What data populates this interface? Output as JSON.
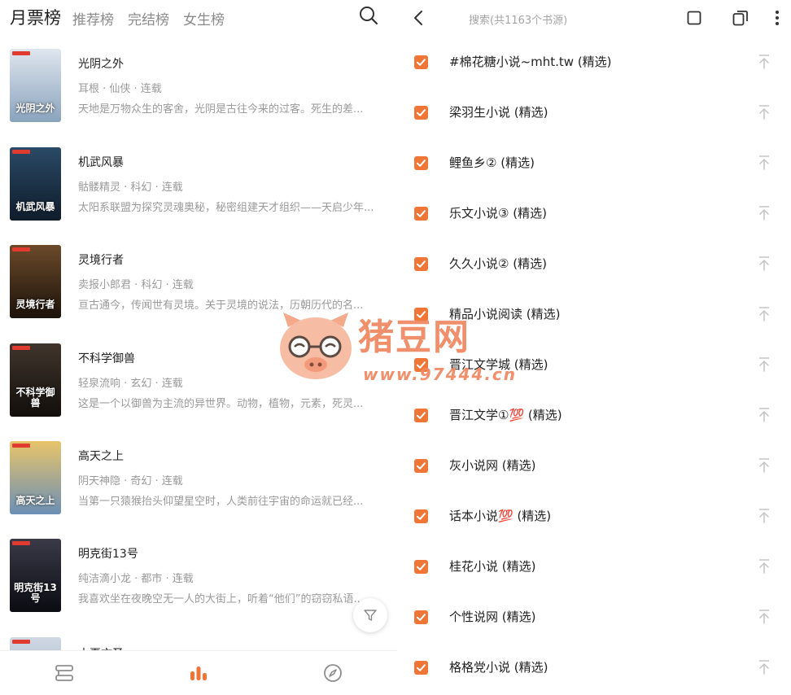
{
  "left": {
    "tabs": [
      {
        "label": "月票榜",
        "active": true
      },
      {
        "label": "推荐榜",
        "active": false
      },
      {
        "label": "完结榜",
        "active": false
      },
      {
        "label": "女生榜",
        "active": false
      }
    ],
    "books": [
      {
        "title": "光阴之外",
        "meta": "耳根 · 仙侠 · 连载",
        "desc": "天地是万物众生的客舍，光阴是古往今来的过客。死生的差...",
        "cover_text": "光阴之外",
        "cover_colors": [
          "#dfe6ee",
          "#8aa3bd"
        ]
      },
      {
        "title": "机武风暴",
        "meta": "骷髅精灵 · 科幻 · 连载",
        "desc": "太阳系联盟为探究灵魂奥秘，秘密组建天才组织——天启少年...",
        "cover_text": "机武风暴",
        "cover_colors": [
          "#2a4a66",
          "#0f1c2b"
        ]
      },
      {
        "title": "灵境行者",
        "meta": "卖报小郎君 · 科幻 · 连载",
        "desc": "亘古通今，传闻世有灵境。关于灵境的说法，历朝历代的名...",
        "cover_text": "灵境行者",
        "cover_colors": [
          "#6b4a2a",
          "#1c120a"
        ]
      },
      {
        "title": "不科学御兽",
        "meta": "轻泉流响 · 玄幻 · 连载",
        "desc": "这是一个以御兽为主流的异世界。动物，植物，元素，死灵...",
        "cover_text": "不科学御兽",
        "cover_colors": [
          "#40352c",
          "#120e0b"
        ]
      },
      {
        "title": "高天之上",
        "meta": "阴天神隐 · 奇幻 · 连载",
        "desc": "当第一只猿猴抬头仰望星空时，人类前往宇宙的命运就已经...",
        "cover_text": "高天之上",
        "cover_colors": [
          "#e8c46a",
          "#6b8fb5"
        ]
      },
      {
        "title": "明克街13号",
        "meta": "纯洁滴小龙 · 都市 · 连载",
        "desc": "我喜欢坐在夜晚空无一人的大街上，听着“他们”的窃窃私语...",
        "cover_text": "明克街13号",
        "cover_colors": [
          "#3a3a48",
          "#0b0b12"
        ]
      },
      {
        "title": "大夏文圣",
        "meta": "",
        "desc": "",
        "cover_text": "",
        "cover_colors": [
          "#cfd8e3",
          "#9aaabb"
        ]
      }
    ],
    "nav": [
      "bookshelf-icon",
      "ranking-icon",
      "discover-icon"
    ],
    "accent": "#ef7637"
  },
  "right": {
    "search_placeholder": "搜索(共1163个书源)",
    "sources": [
      {
        "name": "#棉花糖小说~mht.tw (精选)",
        "checked": true
      },
      {
        "name": "梁羽生小说 (精选)",
        "checked": true
      },
      {
        "name": "鲤鱼乡② (精选)",
        "checked": true
      },
      {
        "name": "乐文小说③ (精选)",
        "checked": true
      },
      {
        "name": "久久小说② (精选)",
        "checked": true
      },
      {
        "name": "精品小说阅读 (精选)",
        "checked": true
      },
      {
        "name": "晋江文学城 (精选)",
        "checked": true
      },
      {
        "name": "晋江文学①💯 (精选)",
        "checked": true
      },
      {
        "name": "灰小说网 (精选)",
        "checked": true
      },
      {
        "name": "话本小说💯 (精选)",
        "checked": true
      },
      {
        "name": "桂花小说 (精选)",
        "checked": true
      },
      {
        "name": "个性说网 (精选)",
        "checked": true
      },
      {
        "name": "格格党小说 (精选)",
        "checked": true
      }
    ],
    "checkbox_color": "#ef7637"
  },
  "watermark": {
    "text": "猪豆网",
    "url": "www.97444.cn"
  }
}
